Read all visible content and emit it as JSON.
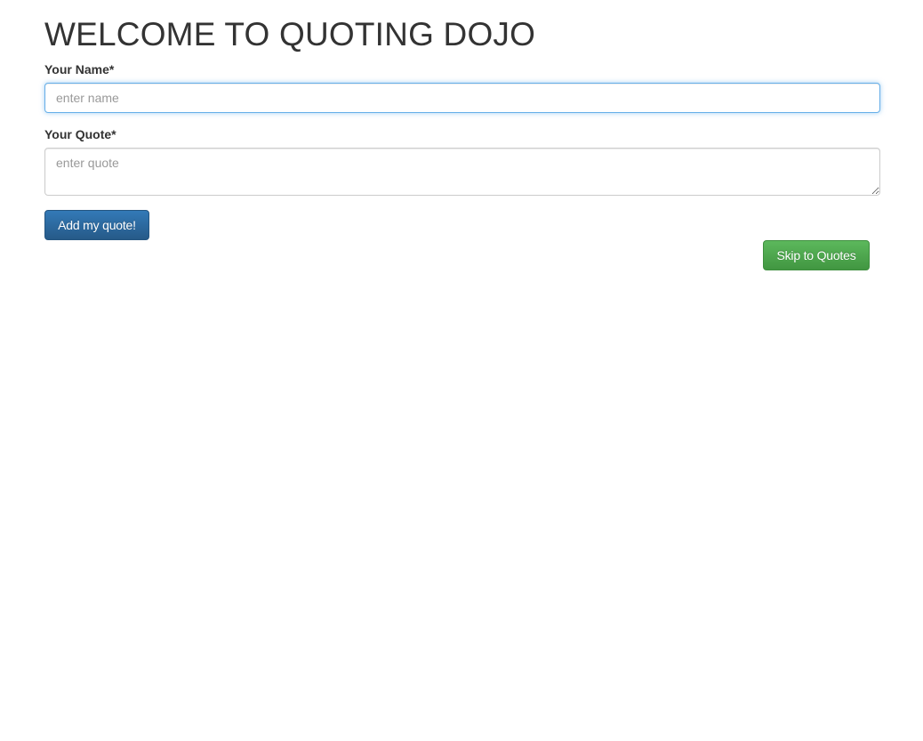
{
  "header": {
    "title": "WELCOME TO QUOTING DOJO"
  },
  "form": {
    "name_label": "Your Name*",
    "name_placeholder": "enter name",
    "name_value": "",
    "quote_label": "Your Quote*",
    "quote_placeholder": "enter quote",
    "quote_value": "",
    "submit_label": "Add my quote!"
  },
  "nav": {
    "skip_label": "Skip to Quotes"
  },
  "colors": {
    "primary_button": "#2e6da4",
    "success_button": "#449d44",
    "focus_border": "#66afe9"
  }
}
